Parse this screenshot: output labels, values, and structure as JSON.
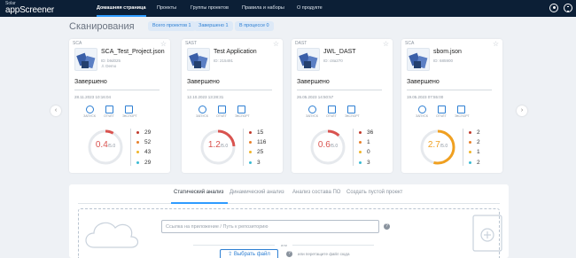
{
  "brand": {
    "small": "Solar",
    "big": "appScreener"
  },
  "nav": {
    "items": [
      {
        "label": "Домашняя страница",
        "active": true
      },
      {
        "label": "Проекты",
        "active": false
      },
      {
        "label": "Группы проектов",
        "active": false
      },
      {
        "label": "Правила и наборы",
        "active": false
      },
      {
        "label": "О продукте",
        "active": false
      }
    ],
    "icons": [
      "user-icon",
      "logout-icon"
    ]
  },
  "scans": {
    "title": "Сканирования",
    "filters": [
      "Всего проектов 1",
      "Завершено 1",
      "В процессе 0"
    ],
    "prev_icon": "‹",
    "next_icon": "›"
  },
  "cards": [
    {
      "type": "SCA",
      "name": "SCA_Test_Project.json",
      "id": "ID: b9d025",
      "owner": "Demo",
      "status": "Завершено",
      "date": "28.11.2023 10:16:04",
      "actions": [
        "ЗАПУСК",
        "ОТЧЁТ",
        "ЭКСПОРТ"
      ],
      "score": "0.4",
      "score_max": "/5.0",
      "score_fraction": 0.08,
      "score_color": "#d9534f",
      "counts": [
        {
          "value": "29",
          "color": "#c0392b"
        },
        {
          "value": "52",
          "color": "#e8802a"
        },
        {
          "value": "43",
          "color": "#f0b428"
        },
        {
          "value": "29",
          "color": "#3bbad3"
        }
      ]
    },
    {
      "type": "SAST",
      "name": "Test Application",
      "id": "ID: 215491",
      "owner": "",
      "status": "Завершено",
      "date": "12.10.2023 13:28:31",
      "actions": [
        "ЗАПУСК",
        "ОТЧЁТ",
        "ЭКСПОРТ"
      ],
      "score": "1.2",
      "score_max": "/5.0",
      "score_fraction": 0.24,
      "score_color": "#d9534f",
      "counts": [
        {
          "value": "15",
          "color": "#c0392b"
        },
        {
          "value": "116",
          "color": "#e8802a"
        },
        {
          "value": "25",
          "color": "#f0b428"
        },
        {
          "value": "3",
          "color": "#3bbad3"
        }
      ]
    },
    {
      "type": "DAST",
      "name": "JWL_DAST",
      "id": "ID: c8a270",
      "owner": "",
      "status": "Завершено",
      "date": "26.05.2023 14:50:57",
      "actions": [
        "ЗАПУСК",
        "ОТЧЁТ",
        "ЭКСПОРТ"
      ],
      "score": "0.6",
      "score_max": "/5.0",
      "score_fraction": 0.12,
      "score_color": "#d9534f",
      "counts": [
        {
          "value": "36",
          "color": "#c0392b"
        },
        {
          "value": "1",
          "color": "#e8802a"
        },
        {
          "value": "0",
          "color": "#f0b428"
        },
        {
          "value": "3",
          "color": "#3bbad3"
        }
      ]
    },
    {
      "type": "SCA",
      "name": "sbom.json",
      "id": "ID: 685900",
      "owner": "",
      "status": "Завершено",
      "date": "19.05.2023 07:55:00",
      "actions": [
        "ЗАПУСК",
        "ОТЧЁТ",
        "ЭКСПОРТ"
      ],
      "score": "2.7",
      "score_max": "/5.0",
      "score_fraction": 0.54,
      "score_color": "#f0a020",
      "counts": [
        {
          "value": "2",
          "color": "#c0392b"
        },
        {
          "value": "2",
          "color": "#e8802a"
        },
        {
          "value": "1",
          "color": "#f0b428"
        },
        {
          "value": "2",
          "color": "#3bbad3"
        }
      ]
    }
  ],
  "analysis": {
    "tabs": [
      "Статический анализ",
      "Динамический анализ",
      "Анализ состава ПО",
      "Создать пустой проект"
    ],
    "active_tab": 0,
    "repo_placeholder": "Ссылка на приложение / Путь к репозиторию",
    "or_label": "или",
    "choose_file": "Выбрать файл",
    "drag_hint": "или перетащите файл сюда"
  },
  "colors": {
    "nav_bg": "#0c1f36",
    "accent": "#2e9bff",
    "link": "#2d7fd3"
  }
}
